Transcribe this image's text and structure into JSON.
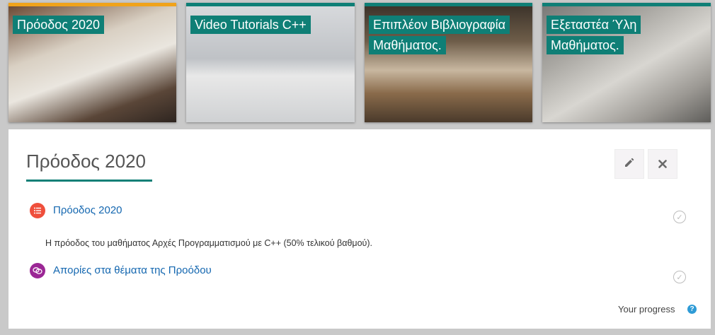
{
  "tiles": [
    {
      "label": "Πρόοδος 2020",
      "active": true
    },
    {
      "label": "Video Tutorials C++",
      "active": false
    },
    {
      "label": "Επιπλέον Βιβλιογραφία Μαθήματος.",
      "active": false
    },
    {
      "label": "Εξεταστέα Ύλη Μαθήματος.",
      "active": false
    }
  ],
  "section": {
    "title": "Πρόοδος 2020",
    "edit_icon": "pencil-icon",
    "close_icon": "close-icon"
  },
  "activities": [
    {
      "icon": "quiz-icon",
      "title": "Πρόοδος 2020",
      "description": "Η πρόοδος του μαθήματος Αρχές Προγραμματισμού με C++ (50% τελικού βαθμού)."
    },
    {
      "icon": "forum-icon",
      "title": "Απορίες στα θέματα της Προόδου"
    }
  ],
  "progress": {
    "label": "Your progress"
  },
  "colors": {
    "accent": "#0f7f76",
    "active_tab": "#f0a31b",
    "link": "#1467b0",
    "quiz": "#ef4f3c",
    "forum": "#9b2795",
    "help": "#2e9bd6"
  }
}
